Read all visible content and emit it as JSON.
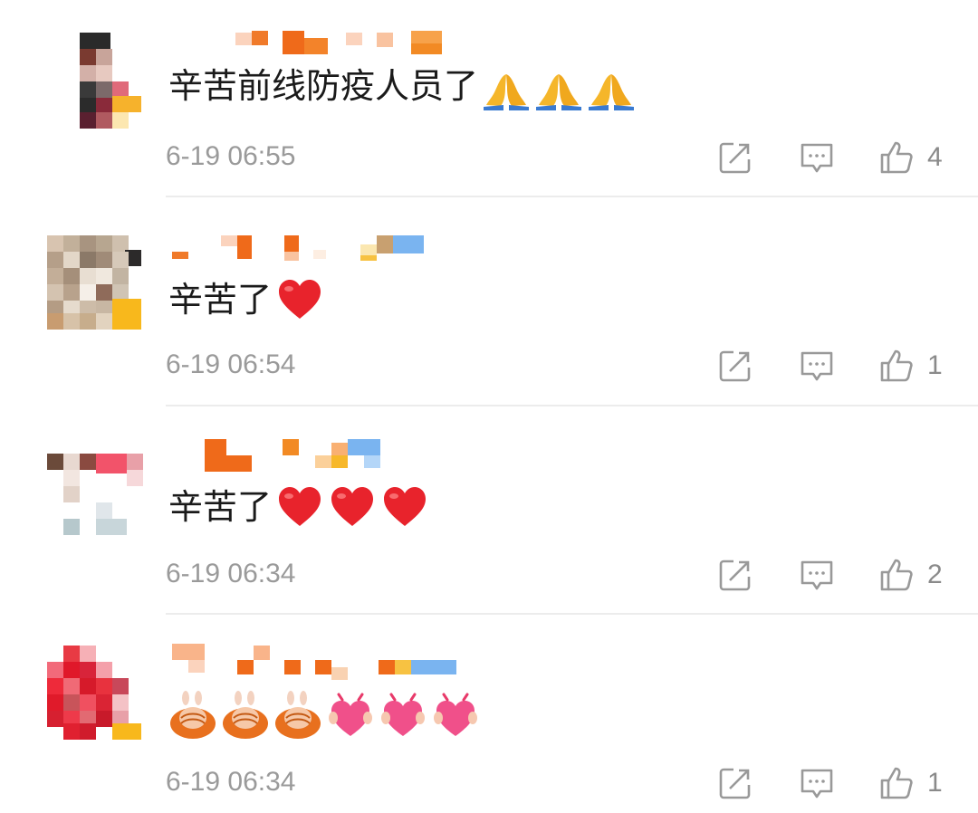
{
  "icons": {
    "share": "share-icon",
    "reply": "comment-icon",
    "like": "thumbs-up-icon"
  },
  "colors": {
    "text": "#1a1a1a",
    "meta": "#9a9a9a",
    "divider": "#ececec"
  },
  "comments": [
    {
      "text": "辛苦前线防疫人员了",
      "emojis": [
        "pray",
        "pray",
        "pray"
      ],
      "time": "6-19 06:55",
      "likes": "4"
    },
    {
      "text": "辛苦了",
      "emojis": [
        "heart"
      ],
      "time": "6-19 06:54",
      "likes": "1"
    },
    {
      "text": "辛苦了",
      "emojis": [
        "heart",
        "heart",
        "heart"
      ],
      "time": "6-19 06:34",
      "likes": "2"
    },
    {
      "text": "",
      "emojis": [
        "bunny-hug",
        "bunny-hug",
        "bunny-hug",
        "heart-hands",
        "heart-hands",
        "heart-hands"
      ],
      "time": "6-19 06:34",
      "likes": "1"
    }
  ]
}
